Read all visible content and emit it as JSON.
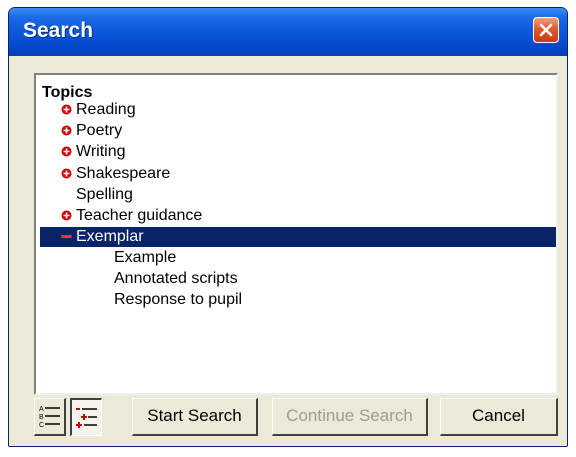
{
  "window": {
    "title": "Search"
  },
  "tree": {
    "root_label": "Topics",
    "items": [
      {
        "label": "Reading",
        "state": "collapsed"
      },
      {
        "label": "Poetry",
        "state": "collapsed"
      },
      {
        "label": "Writing",
        "state": "collapsed"
      },
      {
        "label": "Shakespeare",
        "state": "collapsed"
      },
      {
        "label": "Spelling",
        "state": "leaf"
      },
      {
        "label": "Teacher guidance",
        "state": "collapsed"
      },
      {
        "label": "Exemplar",
        "state": "expanded",
        "selected": true,
        "children": [
          {
            "label": "Example"
          },
          {
            "label": "Annotated scripts"
          },
          {
            "label": "Response to pupil"
          }
        ]
      }
    ]
  },
  "buttons": {
    "start_search": "Start Search",
    "continue_search": "Continue Search",
    "cancel": "Cancel"
  },
  "icons": {
    "close": "close-icon",
    "collapsed": "plus-node-icon",
    "expanded": "minus-node-icon",
    "view_list": "alphabetical-list-icon",
    "view_tree": "tree-list-icon"
  },
  "colors": {
    "title_bar": "#0a55d8",
    "selection": "#0a246a",
    "node_marker": "#cc0000",
    "close_button": "#e0592f"
  }
}
